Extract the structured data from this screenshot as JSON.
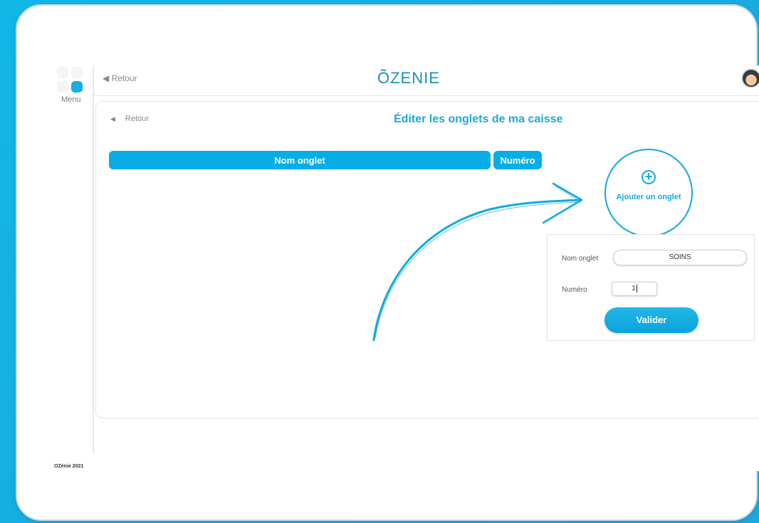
{
  "brand": {
    "logo_text": "ÕZENIE",
    "accent_color": "#06aee5",
    "footer": "OZénie 2021"
  },
  "sidebar": {
    "menu_label": "Menu"
  },
  "topbar": {
    "back_label": "◀ Retour"
  },
  "page": {
    "back_label": "Retour",
    "title": "Éditer les onglets de ma caisse"
  },
  "table": {
    "headers": [
      "Nom onglet",
      "Numéro"
    ]
  },
  "add_tab": {
    "label": "Ajouter un onglet",
    "icon": "plus-circle-icon"
  },
  "form": {
    "name_label": "Nom onglet",
    "name_value": "SOINS",
    "number_label": "Numéro",
    "number_value": "1",
    "submit_label": "Valider"
  }
}
